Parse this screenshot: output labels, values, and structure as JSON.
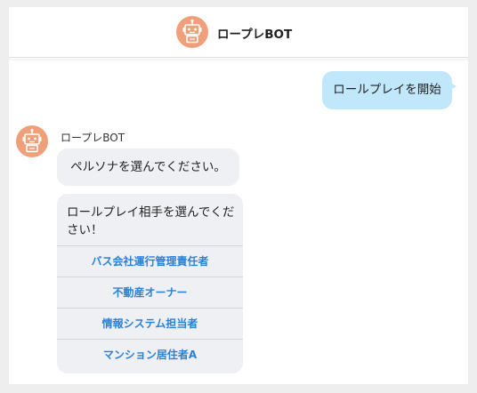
{
  "header": {
    "title": "ロープレBOT"
  },
  "messages": {
    "user_message": "ロールプレイを開始",
    "bot_name": "ロープレBOT",
    "bot_message": "ペルソナを選んでください。",
    "card_prompt": "ロールプレイ相手を選んでください！",
    "options": [
      "バス会社運行管理責任者",
      "不動産オーナー",
      "情報システム担当者",
      "マンション居住者A"
    ]
  },
  "colors": {
    "avatar": "#efa07a",
    "user_bubble": "#c1e7fb",
    "bot_bubble": "#eef0f4",
    "option_text": "#2a82d8"
  },
  "icons": {
    "avatar": "robot-icon"
  }
}
